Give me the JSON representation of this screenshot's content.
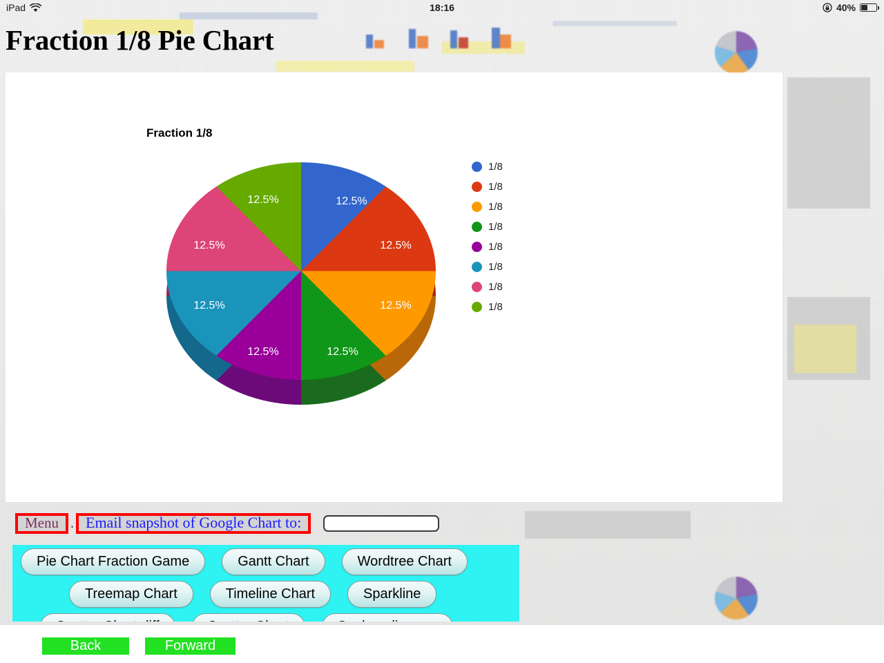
{
  "status_bar": {
    "device_label": "iPad",
    "wifi_icon": "wifi-icon",
    "time": "18:16",
    "rotation_lock_icon": "rotation-lock-icon",
    "battery_percent": "40%",
    "battery_icon": "battery-icon",
    "battery_level": 40
  },
  "page_title": "Fraction 1/8 Pie Chart",
  "chart_data": {
    "type": "pie",
    "title": "Fraction 1/8",
    "three_d": true,
    "categories": [
      "1/8",
      "1/8",
      "1/8",
      "1/8",
      "1/8",
      "1/8",
      "1/8",
      "1/8"
    ],
    "values": [
      12.5,
      12.5,
      12.5,
      12.5,
      12.5,
      12.5,
      12.5,
      12.5
    ],
    "value_labels": [
      "12.5%",
      "12.5%",
      "12.5%",
      "12.5%",
      "12.5%",
      "12.5%",
      "12.5%",
      "12.5%"
    ],
    "colors": [
      "#3366cc",
      "#dc3912",
      "#ff9900",
      "#109618",
      "#990099",
      "#1a94bb",
      "#dd4477",
      "#66aa00"
    ],
    "legend_position": "right",
    "legend_entries": [
      "1/8",
      "1/8",
      "1/8",
      "1/8",
      "1/8",
      "1/8",
      "1/8",
      "1/8"
    ],
    "xlabel": "",
    "ylabel": ""
  },
  "toolbar": {
    "menu_label": "Menu",
    "separator": ".",
    "email_label": "Email snapshot of Google Chart to:",
    "email_input_value": "",
    "email_input_placeholder": ""
  },
  "button_panel": {
    "rows": [
      [
        "Pie Chart Fraction Game",
        "Gantt Chart",
        "Wordtree Chart"
      ],
      [
        "Treemap Chart",
        "Timeline Chart",
        "Sparkline"
      ],
      [
        "Scatter Chart diff",
        "Scatter Chart",
        "Sankey diagram"
      ]
    ]
  },
  "bottom_nav": {
    "back_label": "Back",
    "forward_label": "Forward"
  }
}
